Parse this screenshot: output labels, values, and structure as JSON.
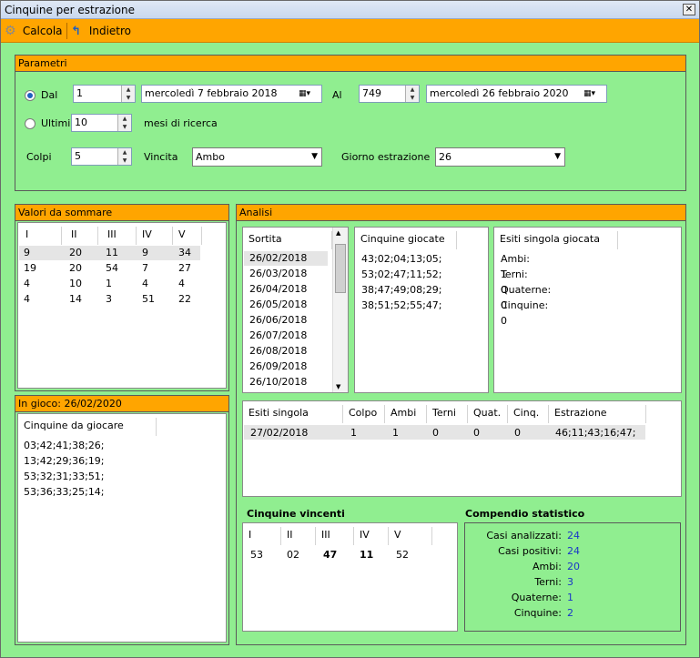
{
  "window": {
    "title": "Cinquine per estrazione",
    "close_glyph": "✕"
  },
  "toolbar": {
    "calcola": "Calcola",
    "indietro": "Indietro"
  },
  "parametri": {
    "header": "Parametri",
    "dal_label": "Dal",
    "dal_value": "1",
    "dal_date": "mercoledì  7  febbraio  2018",
    "al_label": "Al",
    "al_value": "749",
    "al_date": "mercoledì 26  febbraio  2020",
    "ultimi_label": "Ultimi",
    "ultimi_value": "10",
    "mesi_label": "mesi di ricerca",
    "colpi_label": "Colpi",
    "colpi_value": "5",
    "vincita_label": "Vincita",
    "vincita_value": "Ambo",
    "giorno_label": "Giorno estrazione",
    "giorno_value": "26",
    "selected_mode": "Dal"
  },
  "valori": {
    "header": "Valori da sommare",
    "columns": [
      "I",
      "II",
      "III",
      "IV",
      "V"
    ],
    "rows": [
      [
        "9",
        "20",
        "11",
        "9",
        "34"
      ],
      [
        "19",
        "20",
        "54",
        "7",
        "27"
      ],
      [
        "4",
        "10",
        "1",
        "4",
        "4"
      ],
      [
        "4",
        "14",
        "3",
        "51",
        "22"
      ]
    ]
  },
  "ingioco": {
    "header": "In gioco: 26/02/2020",
    "column": "Cinquine da giocare",
    "rows": [
      "03;42;41;38;26;",
      "13;42;29;36;19;",
      "53;32;31;33;51;",
      "53;36;33;25;14;"
    ]
  },
  "analisi": {
    "header": "Analisi",
    "sortita": {
      "column": "Sortita",
      "rows": [
        "26/02/2018",
        "26/03/2018",
        "26/04/2018",
        "26/05/2018",
        "26/06/2018",
        "26/07/2018",
        "26/08/2018",
        "26/09/2018",
        "26/10/2018"
      ]
    },
    "cinquine_giocate": {
      "column": "Cinquine giocate",
      "rows": [
        "43;02;04;13;05;",
        "53;02;47;11;52;",
        "38;47;49;08;29;",
        "38;51;52;55;47;"
      ]
    },
    "esiti": {
      "column": "Esiti singola giocata",
      "rows": [
        "Ambi: 1",
        "Terni: 0",
        "Quaterne: 0",
        "Cinquine: 0"
      ]
    },
    "dettaglio": {
      "columns": [
        "Esiti singola giocata",
        "Colpo",
        "Ambi",
        "Terni",
        "Quat.",
        "Cinq.",
        "Estrazione"
      ],
      "row": [
        "27/02/2018",
        "1",
        "1",
        "0",
        "0",
        "0",
        "46;11;43;16;47;"
      ]
    },
    "cinquine_vincenti": {
      "title": "Cinquine vincenti",
      "columns": [
        "I",
        "II",
        "III",
        "IV",
        "V"
      ],
      "row": [
        "53",
        "02",
        "47",
        "11",
        "52"
      ]
    },
    "compendio": {
      "title": "Compendio statistico",
      "items": [
        {
          "label": "Casi analizzati:",
          "value": "24"
        },
        {
          "label": "Casi positivi:",
          "value": "24"
        },
        {
          "label": "Ambi:",
          "value": "20"
        },
        {
          "label": "Terni:",
          "value": "3"
        },
        {
          "label": "Quaterne:",
          "value": "1"
        },
        {
          "label": "Cinquine:",
          "value": "2"
        }
      ]
    }
  },
  "colors": {
    "accent": "#ffa500",
    "background": "#90ee90",
    "value_blue": "#1a35c8"
  }
}
